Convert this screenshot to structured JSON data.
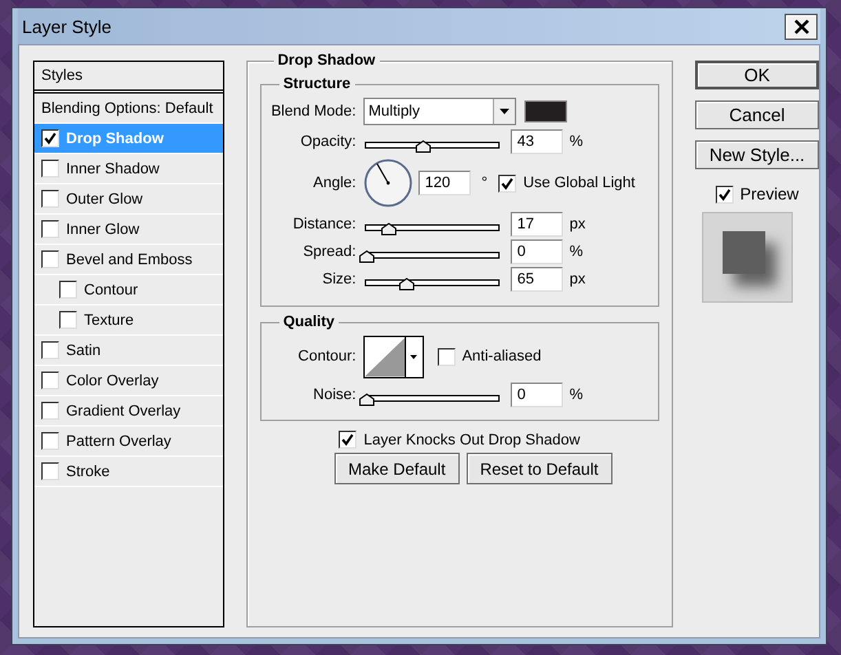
{
  "window": {
    "title": "Layer Style"
  },
  "styles_panel": {
    "header": "Styles",
    "items": [
      {
        "label": "Blending Options: Default",
        "kind": "plain",
        "selected": false
      },
      {
        "label": "Drop Shadow",
        "kind": "check",
        "checked": true,
        "selected": true
      },
      {
        "label": "Inner Shadow",
        "kind": "check",
        "checked": false,
        "selected": false
      },
      {
        "label": "Outer Glow",
        "kind": "check",
        "checked": false,
        "selected": false
      },
      {
        "label": "Inner Glow",
        "kind": "check",
        "checked": false,
        "selected": false
      },
      {
        "label": "Bevel and Emboss",
        "kind": "check",
        "checked": false,
        "selected": false,
        "children": [
          {
            "label": "Contour",
            "kind": "check",
            "checked": false,
            "selected": false
          },
          {
            "label": "Texture",
            "kind": "check",
            "checked": false,
            "selected": false
          }
        ]
      },
      {
        "label": "Satin",
        "kind": "check",
        "checked": false,
        "selected": false
      },
      {
        "label": "Color Overlay",
        "kind": "check",
        "checked": false,
        "selected": false
      },
      {
        "label": "Gradient Overlay",
        "kind": "check",
        "checked": false,
        "selected": false
      },
      {
        "label": "Pattern Overlay",
        "kind": "check",
        "checked": false,
        "selected": false
      },
      {
        "label": "Stroke",
        "kind": "check",
        "checked": false,
        "selected": false
      }
    ]
  },
  "drop_shadow": {
    "title": "Drop Shadow",
    "structure": {
      "title": "Structure",
      "rows": [
        {
          "kind": "dropdown",
          "label": "Blend Mode:",
          "value": "Multiply",
          "color": "#231f20"
        },
        {
          "kind": "slider",
          "label": "Opacity:",
          "level": 0.43,
          "value": "43",
          "unit": "%"
        },
        {
          "kind": "angle",
          "label": "Angle:",
          "value": "120",
          "unit": "°",
          "check": {
            "label": "Use Global Light",
            "checked": true
          }
        },
        {
          "kind": "slider",
          "label": "Distance:",
          "level": 0.17,
          "value": "17",
          "unit": "px"
        },
        {
          "kind": "slider",
          "label": "Spread:",
          "level": 0,
          "value": "0",
          "unit": "%"
        },
        {
          "kind": "slider",
          "label": "Size:",
          "level": 0.3,
          "value": "65",
          "unit": "px"
        }
      ]
    },
    "quality": {
      "title": "Quality",
      "rows": [
        {
          "kind": "contour",
          "label": "Contour:",
          "check": {
            "label": "Anti-aliased",
            "checked": false
          }
        },
        {
          "kind": "slider",
          "label": "Noise:",
          "level": 0,
          "value": "0",
          "unit": "%"
        }
      ]
    },
    "knockout": {
      "label": "Layer Knocks Out Drop Shadow",
      "checked": true
    },
    "buttons": [
      "Make Default",
      "Reset to Default"
    ]
  },
  "side": {
    "buttons": [
      {
        "label": "OK",
        "default": true
      },
      {
        "label": "Cancel",
        "default": false
      },
      {
        "label": "New Style...",
        "default": false
      }
    ],
    "preview": {
      "label": "Preview",
      "checked": true
    }
  }
}
